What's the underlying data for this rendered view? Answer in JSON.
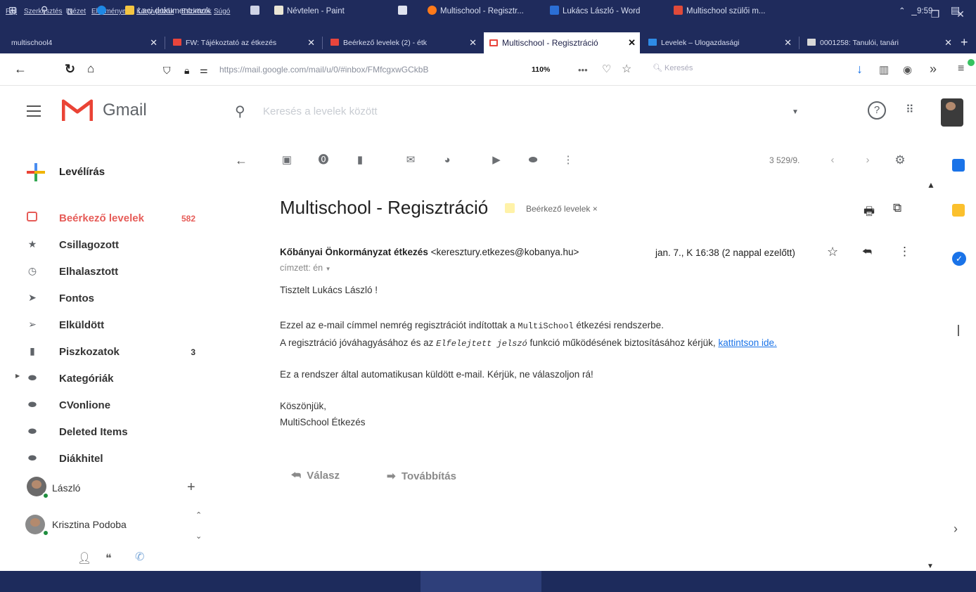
{
  "browser": {
    "menu": [
      "Fájl",
      "Szerkesztés",
      "Nézet",
      "Előzmények",
      "Könyvjelzők",
      "Eszközök",
      "Súgó"
    ],
    "tabs": [
      {
        "label": "multischool4",
        "icon": "none"
      },
      {
        "label": "FW: Tájékoztató az étkezés",
        "icon": "gmail-icon"
      },
      {
        "label": "Beérkező levelek (2) - étk",
        "icon": "gmail-icon"
      },
      {
        "label": "Multischool - Regisztráció",
        "icon": "gmail-icon"
      },
      {
        "label": "Levelek – Ulogazdasági",
        "icon": "outlook-icon"
      },
      {
        "label": "0001258: Tanulói, tanári",
        "icon": "page-icon"
      }
    ],
    "url": "https://mail.google.com/mail/u/0/#inbox/FMfcgxwGCkbB",
    "zoom": "110%",
    "search_placeholder": "Keresés"
  },
  "gmail": {
    "brand": "Gmail",
    "search_placeholder": "Keresés a levelek között",
    "compose_label": "Levélírás",
    "pagination": "3 529/9.",
    "nav": [
      {
        "label": "Beérkező levelek",
        "count": "582",
        "icon": "inbox-icon",
        "active": true
      },
      {
        "label": "Csillagozott",
        "count": "",
        "icon": "star-icon"
      },
      {
        "label": "Elhalasztott",
        "count": "",
        "icon": "clock-icon"
      },
      {
        "label": "Fontos",
        "count": "",
        "icon": "important-icon"
      },
      {
        "label": "Elküldött",
        "count": "",
        "icon": "send-icon"
      },
      {
        "label": "Piszkozatok",
        "count": "3",
        "icon": "draft-icon"
      },
      {
        "label": "Kategóriák",
        "count": "",
        "icon": "label-icon"
      },
      {
        "label": "CVonlione",
        "count": "",
        "icon": "label-icon"
      },
      {
        "label": "Deleted Items",
        "count": "",
        "icon": "label-icon"
      },
      {
        "label": "Diákhitel",
        "count": "",
        "icon": "label-icon"
      }
    ],
    "hangouts": [
      {
        "name": "László"
      },
      {
        "name": "Krisztina Podoba"
      }
    ],
    "mail": {
      "subject": "Multischool - Regisztráció",
      "label_chip": "Beérkező levelek",
      "sender_name": "Kőbányai Önkormányzat étkezés",
      "sender_email": "<keresztury.etkezes@kobanya.hu>",
      "date": "jan. 7., K 16:38 (2 nappal ezelőtt)",
      "to": "címzett: én",
      "greeting": "Tisztelt Lukács László !",
      "line1_a": "Ezzel az e-mail címmel nemrég regisztrációt indítottak a",
      "line1_mono": "MultiSchool",
      "line1_b": "étkezési rendszerbe.",
      "line2_a": "A regisztráció jóváhagyásához és az",
      "line2_mono": "Elfelejtett jelszó",
      "line2_b": "funkció működésének biztosításához kérjük,",
      "line2_link": "kattintson ide.",
      "line3": "Ez a rendszer által automatikusan küldött e-mail. Kérjük, ne válaszoljon rá!",
      "sign1": "Köszönjük,",
      "sign2": "MultiSchool Étkezés",
      "reply": "Válasz",
      "forward": "Továbbítás"
    }
  },
  "taskbar": {
    "items": [
      {
        "label": "Laci dokumentumok"
      },
      {
        "label": "Névtelen - Paint"
      },
      {
        "label": "Multischool - Regisztr..."
      },
      {
        "label": "Lukács László - Word"
      },
      {
        "label": "Multischool szülői m..."
      }
    ],
    "time": "9:59"
  },
  "colors": {
    "chrome": "#1f2b5c",
    "gmail_red": "#e65c58",
    "link": "#1a73e8"
  }
}
